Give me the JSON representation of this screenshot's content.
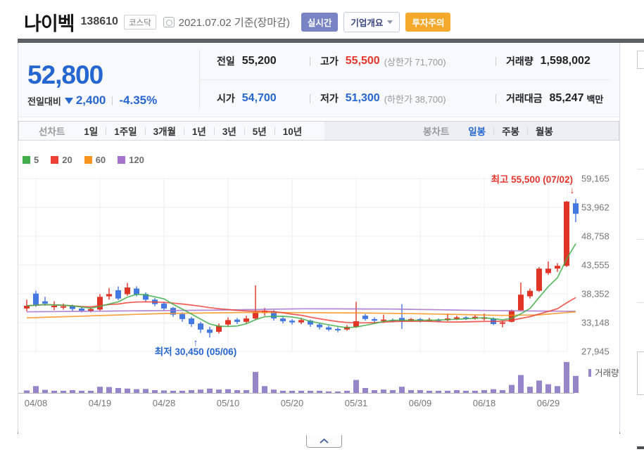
{
  "header": {
    "title": "나이벡",
    "code": "138610",
    "market_badge": "코스닥",
    "date": "2021.07.02 기준(장마감)",
    "realtime_button": "실시간",
    "company_overview_button": "기업개요",
    "warning_badge": "투자주의"
  },
  "summary": {
    "price": "52,800",
    "change_label": "전일대비",
    "change_value": "2,400",
    "change_direction": "down",
    "change_percent": "-4.35%",
    "prev_close_label": "전일",
    "prev_close": "55,200",
    "high_label": "고가",
    "high": "55,500",
    "high_limit": "(상한가 71,700)",
    "open_label": "시가",
    "open": "54,700",
    "low_label": "저가",
    "low": "51,300",
    "low_limit": "(하한가 38,700)",
    "volume_label": "거래량",
    "volume": "1,598,002",
    "value_label": "거래대금",
    "value": "85,247",
    "value_unit": "백만"
  },
  "toolbar": {
    "line_chart_label": "선차트",
    "periods": [
      "1일",
      "1주일",
      "3개월",
      "1년",
      "3년",
      "5년",
      "10년"
    ],
    "candle_chart_label": "봉차트",
    "candle_tabs": [
      "일봉",
      "주봉",
      "월봉"
    ],
    "selected_candle_tab": "일봉"
  },
  "chart_data": {
    "type": "candlestick",
    "title": "나이벡 일봉 차트",
    "ma_legend": [
      {
        "label": "5",
        "color": "#3fae49"
      },
      {
        "label": "20",
        "color": "#ee4136"
      },
      {
        "label": "60",
        "color": "#f79420"
      },
      {
        "label": "120",
        "color": "#a573cc"
      }
    ],
    "y_ticks": [
      "59,165",
      "53,962",
      "48,758",
      "43,555",
      "38,352",
      "33,148",
      "27,945"
    ],
    "y_tick_values": [
      59165,
      53962,
      48758,
      43555,
      38352,
      33148,
      27945
    ],
    "ylim": [
      27945,
      59165
    ],
    "x_ticks": [
      {
        "label": "04/08",
        "index": 1
      },
      {
        "label": "04/19",
        "index": 8
      },
      {
        "label": "04/28",
        "index": 15
      },
      {
        "label": "05/10",
        "index": 22
      },
      {
        "label": "05/20",
        "index": 29
      },
      {
        "label": "05/31",
        "index": 36
      },
      {
        "label": "06/09",
        "index": 43
      },
      {
        "label": "06/18",
        "index": 50
      },
      {
        "label": "06/29",
        "index": 57
      }
    ],
    "annotations": {
      "high": {
        "text": "최고 55,500 (07/02)",
        "arrow": "↓",
        "color": "#e5352c"
      },
      "low": {
        "text": "최저 30,450 (05/06)",
        "arrow": "↑",
        "color": "#2566d0"
      }
    },
    "volume_legend": "거래량",
    "colors": {
      "up": "#e03427",
      "down": "#4579e2",
      "volume": "#9486c8",
      "grid": "#ececec",
      "axis_text": "#767676"
    },
    "candles": [
      [
        35700,
        37300,
        35200,
        36200
      ],
      [
        38400,
        38900,
        36000,
        36400
      ],
      [
        37000,
        37800,
        36200,
        36600
      ],
      [
        36000,
        37000,
        35400,
        36200
      ],
      [
        35900,
        36600,
        35500,
        36100
      ],
      [
        36100,
        36400,
        35200,
        35600
      ],
      [
        35700,
        36000,
        35000,
        35300
      ],
      [
        35300,
        35900,
        35000,
        35600
      ],
      [
        35500,
        38300,
        35300,
        37800
      ],
      [
        37900,
        39400,
        37300,
        38300
      ],
      [
        39000,
        39700,
        37200,
        37500
      ],
      [
        38300,
        40300,
        38000,
        39500
      ],
      [
        39300,
        39700,
        37900,
        38200
      ],
      [
        38300,
        38600,
        36900,
        37300
      ],
      [
        37300,
        37600,
        36100,
        36500
      ],
      [
        36600,
        36900,
        35300,
        35700
      ],
      [
        35800,
        36000,
        34200,
        34600
      ],
      [
        34700,
        35000,
        33300,
        33800
      ],
      [
        33900,
        34200,
        32400,
        32900
      ],
      [
        33000,
        33300,
        31300,
        31900
      ],
      [
        31900,
        32400,
        30450,
        31300
      ],
      [
        31500,
        33000,
        31200,
        32600
      ],
      [
        32800,
        34100,
        32500,
        33600
      ],
      [
        33700,
        34000,
        32900,
        33300
      ],
      [
        33300,
        34400,
        33000,
        33900
      ],
      [
        33900,
        39900,
        33600,
        35000
      ],
      [
        34900,
        35800,
        34400,
        35300
      ],
      [
        35200,
        35400,
        33500,
        33900
      ],
      [
        33900,
        34200,
        33000,
        33400
      ],
      [
        33500,
        33800,
        32800,
        33200
      ],
      [
        33200,
        34000,
        32900,
        33600
      ],
      [
        33500,
        33700,
        32400,
        32800
      ],
      [
        32800,
        33100,
        31900,
        32300
      ],
      [
        32300,
        32600,
        31600,
        31900
      ],
      [
        32000,
        32300,
        31400,
        31800
      ],
      [
        31900,
        32700,
        31700,
        32400
      ],
      [
        32400,
        36900,
        32200,
        33400
      ],
      [
        34400,
        34700,
        33500,
        33800
      ],
      [
        33800,
        34100,
        33200,
        33500
      ],
      [
        33500,
        34600,
        33100,
        33700
      ],
      [
        33600,
        33900,
        33200,
        33500
      ],
      [
        34000,
        36500,
        32000,
        33400
      ],
      [
        33600,
        34000,
        33300,
        33800
      ],
      [
        33800,
        34000,
        33200,
        33500
      ],
      [
        33500,
        34000,
        33400,
        33700
      ],
      [
        33700,
        33900,
        33300,
        33600
      ],
      [
        33600,
        34800,
        33400,
        33900
      ],
      [
        33900,
        34400,
        33600,
        34100
      ],
      [
        34100,
        34300,
        33600,
        33900
      ],
      [
        33900,
        34500,
        33700,
        34200
      ],
      [
        34000,
        34800,
        33500,
        34100
      ],
      [
        33900,
        34100,
        32700,
        32900
      ],
      [
        33000,
        33500,
        32300,
        33200
      ],
      [
        33300,
        35500,
        33200,
        35300
      ],
      [
        35400,
        40400,
        35200,
        38200
      ],
      [
        37900,
        39300,
        37500,
        38900
      ],
      [
        38900,
        43200,
        38700,
        42900
      ],
      [
        42100,
        44200,
        41800,
        42900
      ],
      [
        42900,
        43900,
        42300,
        43400
      ],
      [
        43400,
        55100,
        43200,
        55000
      ],
      [
        54700,
        55500,
        51300,
        52800
      ]
    ],
    "volume_rel": [
      8,
      22,
      10,
      7,
      7,
      9,
      7,
      7,
      20,
      19,
      16,
      14,
      12,
      13,
      9,
      8,
      7,
      7,
      9,
      11,
      14,
      11,
      12,
      9,
      9,
      68,
      22,
      11,
      7,
      7,
      7,
      7,
      7,
      5,
      5,
      7,
      42,
      16,
      9,
      11,
      9,
      20,
      9,
      9,
      7,
      7,
      7,
      9,
      7,
      7,
      9,
      12,
      9,
      26,
      58,
      20,
      40,
      28,
      22,
      100,
      55
    ],
    "ma60_keypoints": [
      [
        0,
        34000
      ],
      [
        15,
        34800
      ],
      [
        25,
        35000
      ],
      [
        36,
        34900
      ],
      [
        45,
        34700
      ],
      [
        52,
        34450
      ],
      [
        56,
        34550
      ],
      [
        60,
        35100
      ]
    ],
    "ma120_keypoints": [
      [
        0,
        35100
      ],
      [
        10,
        35250
      ],
      [
        20,
        35400
      ],
      [
        30,
        35650
      ],
      [
        40,
        35600
      ],
      [
        50,
        35350
      ],
      [
        55,
        35250
      ],
      [
        60,
        35200
      ]
    ]
  }
}
